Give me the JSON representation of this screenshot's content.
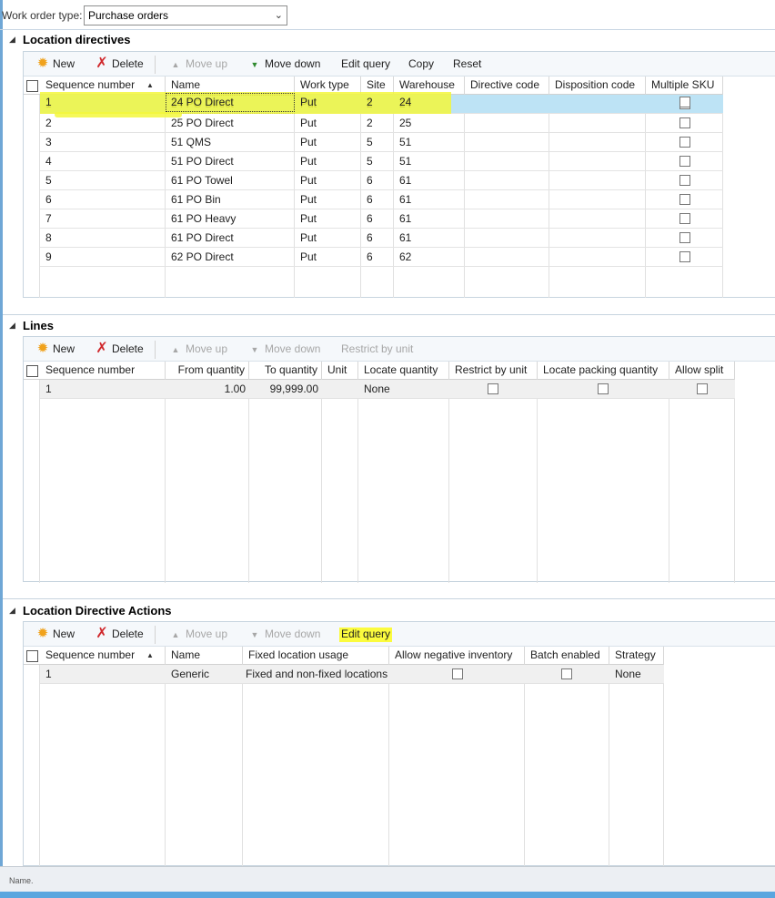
{
  "filter": {
    "label": "Work order type:",
    "value": "Purchase orders"
  },
  "location_directives": {
    "title": "Location directives",
    "toolbar": {
      "new": "New",
      "delete": "Delete",
      "move_up": "Move up",
      "move_down": "Move down",
      "edit_query": "Edit query",
      "copy": "Copy",
      "reset": "Reset"
    },
    "columns": [
      "Sequence number",
      "Name",
      "Work type",
      "Site",
      "Warehouse",
      "Directive code",
      "Disposition code",
      "Multiple SKU"
    ],
    "rows": [
      [
        "1",
        "24 PO Direct",
        "Put",
        "2",
        "24",
        "",
        ""
      ],
      [
        "2",
        "25 PO Direct",
        "Put",
        "2",
        "25",
        "",
        ""
      ],
      [
        "3",
        "51 QMS",
        "Put",
        "5",
        "51",
        "",
        ""
      ],
      [
        "4",
        "51 PO Direct",
        "Put",
        "5",
        "51",
        "",
        ""
      ],
      [
        "5",
        "61 PO Towel",
        "Put",
        "6",
        "61",
        "",
        ""
      ],
      [
        "6",
        "61 PO Bin",
        "Put",
        "6",
        "61",
        "",
        ""
      ],
      [
        "7",
        "61 PO Heavy",
        "Put",
        "6",
        "61",
        "",
        ""
      ],
      [
        "8",
        "61 PO Direct",
        "Put",
        "6",
        "61",
        "",
        ""
      ],
      [
        "9",
        "62 PO Direct",
        "Put",
        "6",
        "62",
        "",
        ""
      ]
    ],
    "multiple_sku": [
      false,
      false,
      false,
      false,
      false,
      false,
      false,
      false,
      false
    ],
    "selected_row": 0
  },
  "lines": {
    "title": "Lines",
    "toolbar": {
      "new": "New",
      "delete": "Delete",
      "move_up": "Move up",
      "move_down": "Move down",
      "restrict_by_unit": "Restrict by unit"
    },
    "columns": [
      "Sequence number",
      "From quantity",
      "To quantity",
      "Unit",
      "Locate quantity",
      "Restrict by unit",
      "Locate packing quantity",
      "Allow split"
    ],
    "rows": [
      {
        "seq": "1",
        "from": "1.00",
        "to": "99,999.00",
        "unit": "",
        "locate": "None",
        "restrict": false,
        "packing": false,
        "allow_split": false
      }
    ]
  },
  "actions": {
    "title": "Location Directive Actions",
    "toolbar": {
      "new": "New",
      "delete": "Delete",
      "move_up": "Move up",
      "move_down": "Move down",
      "edit_query": "Edit query"
    },
    "columns": [
      "Sequence number",
      "Name",
      "Fixed location usage",
      "Allow negative inventory",
      "Batch enabled",
      "Strategy"
    ],
    "rows": [
      {
        "seq": "1",
        "name": "Generic",
        "usage": "Fixed and non-fixed locations",
        "allow_negative": false,
        "batch": false,
        "strategy": "None"
      }
    ]
  },
  "status": {
    "text": "Name."
  },
  "colors": {
    "highlight": "#f3f73c",
    "selected_row": "#bde3f5",
    "accent": "#5aa6df"
  }
}
